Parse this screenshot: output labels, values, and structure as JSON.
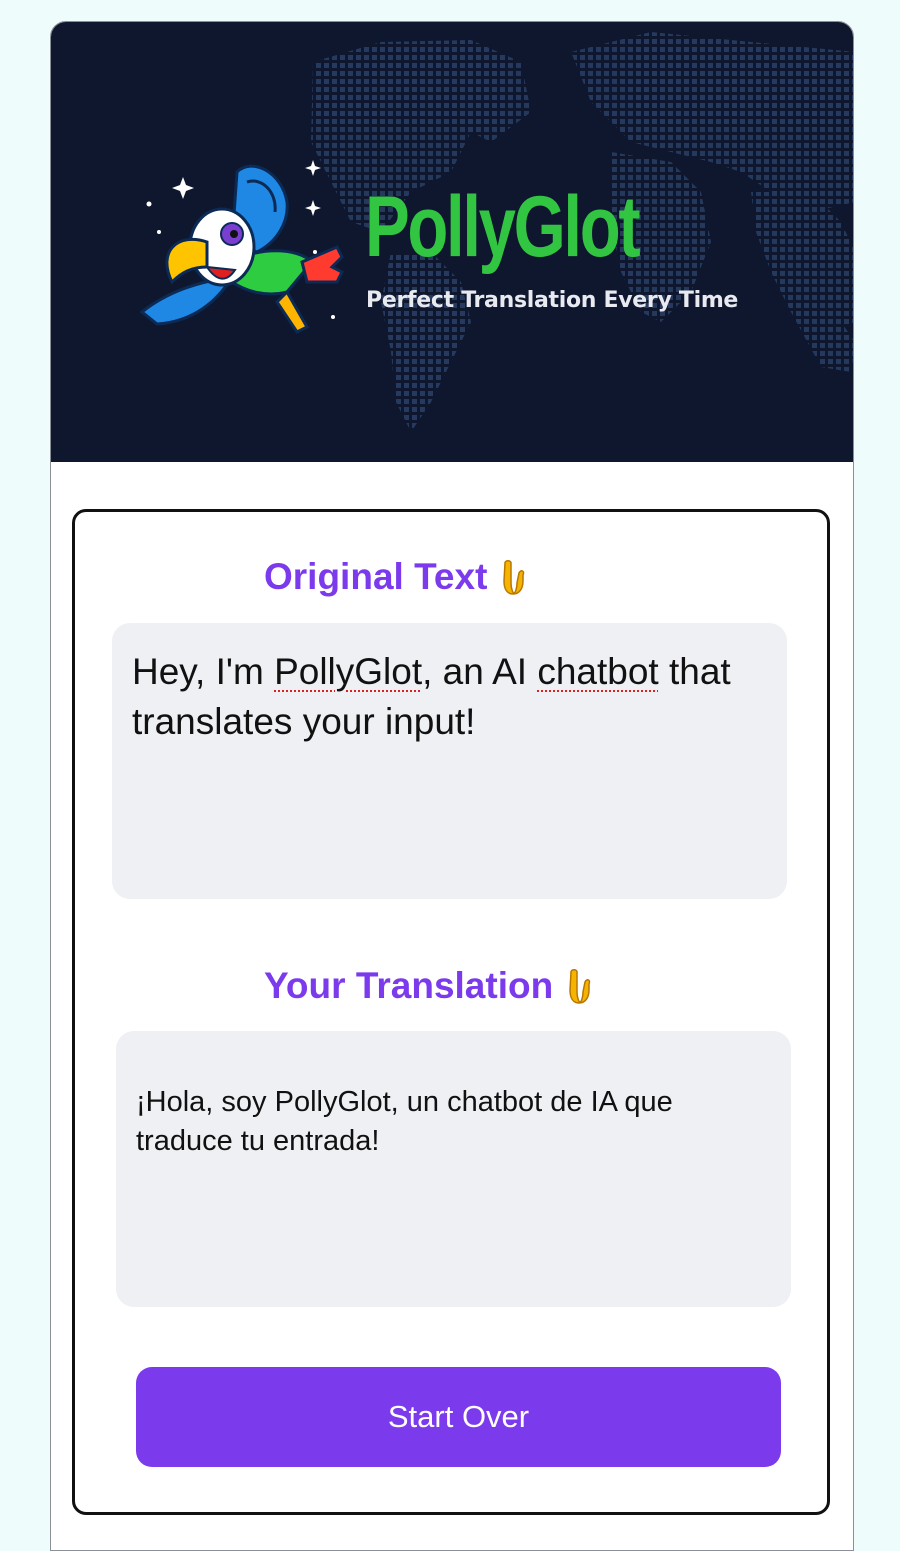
{
  "header": {
    "brand_name": "PollyGlot",
    "tagline": "Perfect Translation Every Time"
  },
  "original": {
    "heading": "Original Text",
    "text_part1": "Hey, I'm ",
    "text_word1": "PollyGlot",
    "text_part2": ", an AI ",
    "text_word2": "chatbot",
    "text_part3": " that translates your input!"
  },
  "translation": {
    "heading": "Your Translation",
    "text": "¡Hola, soy PollyGlot, un chatbot de IA que traduce tu entrada!"
  },
  "actions": {
    "start_over_label": "Start Over"
  },
  "icons": {
    "heading_icon": "pointing-down-hand-icon",
    "logo": "parrot-logo-icon"
  },
  "colors": {
    "accent": "#7c3aed",
    "brand_green": "#32c542",
    "header_bg": "#0f172e",
    "textbox_bg": "#eff0f3"
  }
}
